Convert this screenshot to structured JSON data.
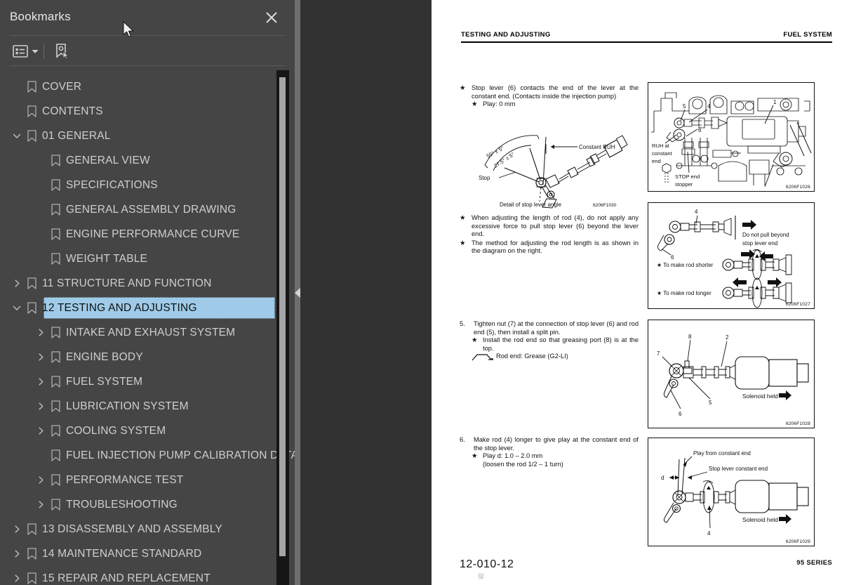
{
  "window": {
    "background_color": "#2b2b2b"
  },
  "bookmarks_panel": {
    "title": "Bookmarks",
    "close_icon": "close-icon",
    "background_color": "#454545",
    "toolbar": {
      "outline_options_icon": "list-outline-icon",
      "outline_options_caret_icon": "chevron-down-icon",
      "add_bookmark_icon": "bookmark-pointer-icon"
    },
    "selection_color": "#9fcbe8",
    "scrollbar": {
      "thumb_color": "#a6a6a6",
      "track_color": "#161616"
    },
    "items": [
      {
        "label": "COVER",
        "level": 0,
        "twisty": "none",
        "selected": false
      },
      {
        "label": "CONTENTS",
        "level": 0,
        "twisty": "none",
        "selected": false
      },
      {
        "label": "01 GENERAL",
        "level": 0,
        "twisty": "expanded",
        "selected": false
      },
      {
        "label": "GENERAL VIEW",
        "level": 1,
        "twisty": "none",
        "selected": false
      },
      {
        "label": "SPECIFICATIONS",
        "level": 1,
        "twisty": "none",
        "selected": false
      },
      {
        "label": "GENERAL ASSEMBLY DRAWING",
        "level": 1,
        "twisty": "none",
        "selected": false
      },
      {
        "label": "ENGINE PERFORMANCE CURVE",
        "level": 1,
        "twisty": "none",
        "selected": false
      },
      {
        "label": "WEIGHT TABLE",
        "level": 1,
        "twisty": "none",
        "selected": false
      },
      {
        "label": "11 STRUCTURE AND FUNCTION",
        "level": 0,
        "twisty": "collapsed",
        "selected": false
      },
      {
        "label": "12 TESTING AND ADJUSTING",
        "level": 0,
        "twisty": "expanded",
        "selected": true
      },
      {
        "label": "INTAKE AND EXHAUST SYSTEM",
        "level": 1,
        "twisty": "collapsed",
        "selected": false
      },
      {
        "label": "ENGINE BODY",
        "level": 1,
        "twisty": "collapsed",
        "selected": false
      },
      {
        "label": "FUEL SYSTEM",
        "level": 1,
        "twisty": "collapsed",
        "selected": false
      },
      {
        "label": "LUBRICATION SYSTEM",
        "level": 1,
        "twisty": "collapsed",
        "selected": false
      },
      {
        "label": "COOLING SYSTEM",
        "level": 1,
        "twisty": "collapsed",
        "selected": false
      },
      {
        "label": "FUEL INJECTION PUMP CALIBRATION DATA",
        "level": 1,
        "twisty": "none",
        "selected": false
      },
      {
        "label": "PERFORMANCE TEST",
        "level": 1,
        "twisty": "collapsed",
        "selected": false
      },
      {
        "label": "TROUBLESHOOTING",
        "level": 1,
        "twisty": "collapsed",
        "selected": false
      },
      {
        "label": "13 DISASSEMBLY AND ASSEMBLY",
        "level": 0,
        "twisty": "collapsed",
        "selected": false
      },
      {
        "label": "14 MAINTENANCE STANDARD",
        "level": 0,
        "twisty": "collapsed",
        "selected": false
      },
      {
        "label": "15 REPAIR AND REPLACEMENT",
        "level": 0,
        "twisty": "collapsed",
        "selected": false
      }
    ]
  },
  "divider": {
    "collapse_icon": "triangle-left-icon"
  },
  "document": {
    "header": {
      "left": "TESTING AND ADJUSTING",
      "right": "FUEL SYSTEM"
    },
    "footer": {
      "page_number": "12-010-12",
      "circled_number": "⑫",
      "series": "95 SERIES"
    },
    "blocks": {
      "b1": {
        "marker": "★",
        "text": "Stop lever (6) contacts the end of the lever at the constant end. (Contacts inside the injection pump)",
        "sub_marker": "★",
        "sub_text": "Play: 0 mm"
      },
      "b2": {
        "marker1": "★",
        "text1": "When adjusting the length of rod (4), do not apply any excessive force to pull stop lever (6) beyond the lever end.",
        "marker2": "★",
        "text2": "The method for adjusting the rod length is as shown in the diagram on the right."
      },
      "b3": {
        "number": "5.",
        "text": "Tighten nut (7) at the connection of stop lever (6) and rod end (5), then install a split pin.",
        "sub_marker": "★",
        "sub_text": "Install the rod end so that greasing port (8) is at the top.",
        "grease_icon": "grease-symbol-icon",
        "grease_text": "Rod end: Grease (G2-LI)"
      },
      "b4": {
        "number": "6.",
        "text": "Make rod (4) longer to give play at the constant end of the stop lever.",
        "sub_marker": "★",
        "sub_text": "Play d: 1.0 – 2.0 mm",
        "sub_text2": "(loosen the rod 1/2 – 1 turn)"
      }
    },
    "figures": {
      "inline_stop_lever": {
        "caption": "Detail of stop lever angle",
        "id": "6206F1030",
        "labels": {
          "angle_outer": "55° ± 5°",
          "angle_inner": "27.5° ± 5°",
          "constant": "Constant RUH",
          "stop": "Stop"
        }
      },
      "fig1": {
        "id": "6206F1026",
        "callouts": [
          "1",
          "4",
          "5",
          "6"
        ],
        "labels": [
          "RUH at constant end",
          "STOP end stopper"
        ]
      },
      "fig2": {
        "id": "6206F1027",
        "callouts": [
          "4",
          "6"
        ],
        "labels": [
          "Do not pull beyond stop lever end",
          "★ To make rod shorter",
          "★ To make rod longer"
        ]
      },
      "fig3": {
        "id": "6206F1028",
        "callouts": [
          "2",
          "5",
          "6",
          "7",
          "8"
        ],
        "labels": [
          "Solenoid held"
        ]
      },
      "fig4": {
        "id": "6206F1029",
        "callouts": [
          "d",
          "4"
        ],
        "labels": [
          "Play from constant end",
          "Stop lever constant end",
          "Solenoid held"
        ]
      }
    }
  },
  "cursor": {
    "icon": "mouse-pointer-icon"
  }
}
